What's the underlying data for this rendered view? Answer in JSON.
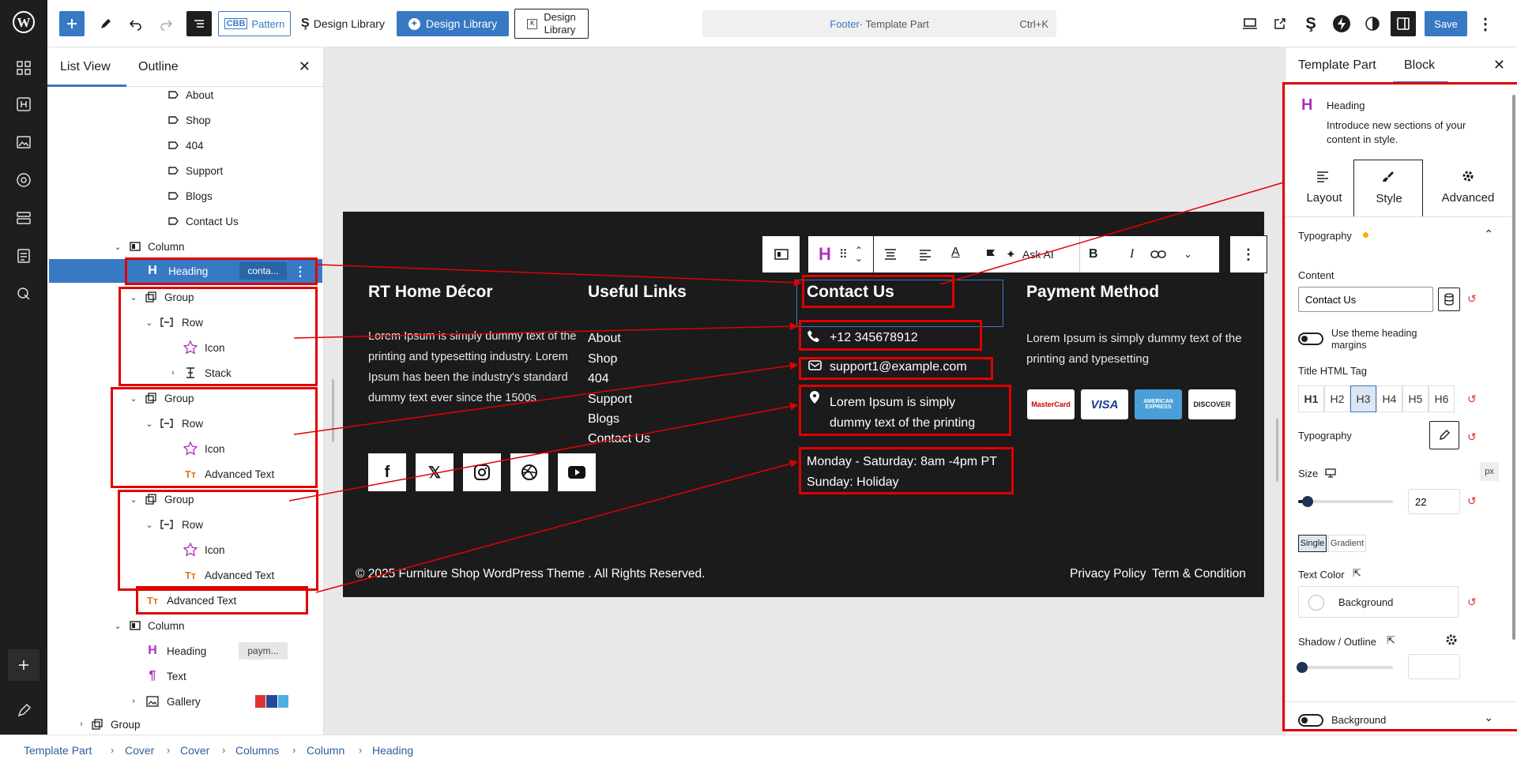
{
  "topbar": {
    "pattern_label": "Pattern",
    "cbb_label": "CBB",
    "design_library_1": "Design Library",
    "design_library_2": "Design Library",
    "design_library_3_line1": "Design",
    "design_library_3_line2": "Library",
    "doc_title_part1": "Footer",
    "doc_title_part2": " · Template Part",
    "shortcut": "Ctrl+K",
    "save_label": "Save"
  },
  "listview": {
    "tab_list": "List View",
    "tab_outline": "Outline",
    "rows": [
      {
        "label": "About"
      },
      {
        "label": "Shop"
      },
      {
        "label": "404"
      },
      {
        "label": "Support"
      },
      {
        "label": "Blogs"
      },
      {
        "label": "Contact Us"
      },
      {
        "label": "Column"
      },
      {
        "label": "Heading",
        "badge": "conta..."
      },
      {
        "label": "Group"
      },
      {
        "label": "Row"
      },
      {
        "label": "Icon"
      },
      {
        "label": "Stack"
      },
      {
        "label": "Group"
      },
      {
        "label": "Row"
      },
      {
        "label": "Icon"
      },
      {
        "label": "Advanced Text"
      },
      {
        "label": "Group"
      },
      {
        "label": "Row"
      },
      {
        "label": "Icon"
      },
      {
        "label": "Advanced Text"
      },
      {
        "label": "Advanced Text"
      },
      {
        "label": "Column"
      },
      {
        "label": "Heading",
        "badge": "paym..."
      },
      {
        "label": "Text"
      },
      {
        "label": "Gallery"
      },
      {
        "label": "Group"
      }
    ]
  },
  "footer": {
    "brand_heading": "RT Home Décor",
    "brand_text": "Lorem Ipsum is simply dummy text of the printing and typesetting industry. Lorem Ipsum has been the industry's standard dummy text ever since the 1500s.",
    "links_heading": "Useful Links",
    "links": [
      "About",
      "Shop",
      "404",
      "Support",
      "Blogs",
      "Contact Us"
    ],
    "contact_heading": "Contact Us",
    "phone": "+12 345678912",
    "email": "support1@example.com",
    "address_line1": "Lorem Ipsum is simply",
    "address_line2": "dummy text of the printing",
    "hours_line1": "Monday - Saturday: 8am -4pm PT",
    "hours_line2": "Sunday: Holiday",
    "payment_heading": "Payment Method",
    "payment_text": "Lorem Ipsum is simply dummy text of the printing and typesetting",
    "cards": [
      "MasterCard",
      "VISA",
      "AMERICAN EXPRESS",
      "DISCOVER"
    ],
    "copyright": "© 2025 Furniture Shop WordPress Theme . All Rights Reserved.",
    "privacy": "Privacy Policy",
    "terms": "Term & Condition"
  },
  "blocktoolbar": {
    "ask_ai": "Ask AI"
  },
  "rightpanel": {
    "tab_template_part": "Template Part",
    "tab_block": "Block",
    "block_name": "Heading",
    "block_desc": "Introduce new sections of your content in style.",
    "tabs": [
      "Layout",
      "Style",
      "Advanced"
    ],
    "typography_section": "Typography",
    "content_label": "Content",
    "content_value": "Contact Us",
    "theme_margins_label": "Use theme heading margins",
    "html_tag_label": "Title HTML Tag",
    "html_tags": [
      "H1",
      "H2",
      "H3",
      "H4",
      "H5",
      "H6"
    ],
    "typography_label": "Typography",
    "size_label": "Size",
    "size_unit": "px",
    "size_value": "22",
    "size_fraction": 0.1,
    "single_label": "Single",
    "gradient_label": "Gradient",
    "text_color_label": "Text Color",
    "background_option": "Background",
    "shadow_label": "Shadow / Outline",
    "background_toggle_label": "Background"
  },
  "breadcrumb": [
    "Template Part",
    "Cover",
    "Cover",
    "Columns",
    "Column",
    "Heading"
  ],
  "colors": {
    "accent": "#3879c4",
    "annotation": "#e00000",
    "footer_bg": "#1b1b1b",
    "heading_icon": "#b12fc0"
  }
}
